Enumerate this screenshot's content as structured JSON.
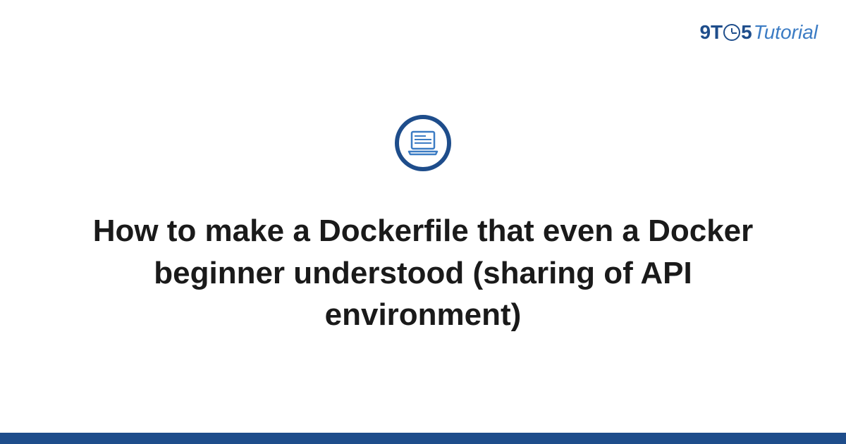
{
  "brand": {
    "part1": "9T",
    "part2": "5",
    "part3": "Tutorial"
  },
  "article": {
    "title": "How to make a Dockerfile that even a Docker beginner understood (sharing of API environment)"
  },
  "colors": {
    "brand_primary": "#1e4d8b",
    "brand_secondary": "#3c7cc4"
  }
}
